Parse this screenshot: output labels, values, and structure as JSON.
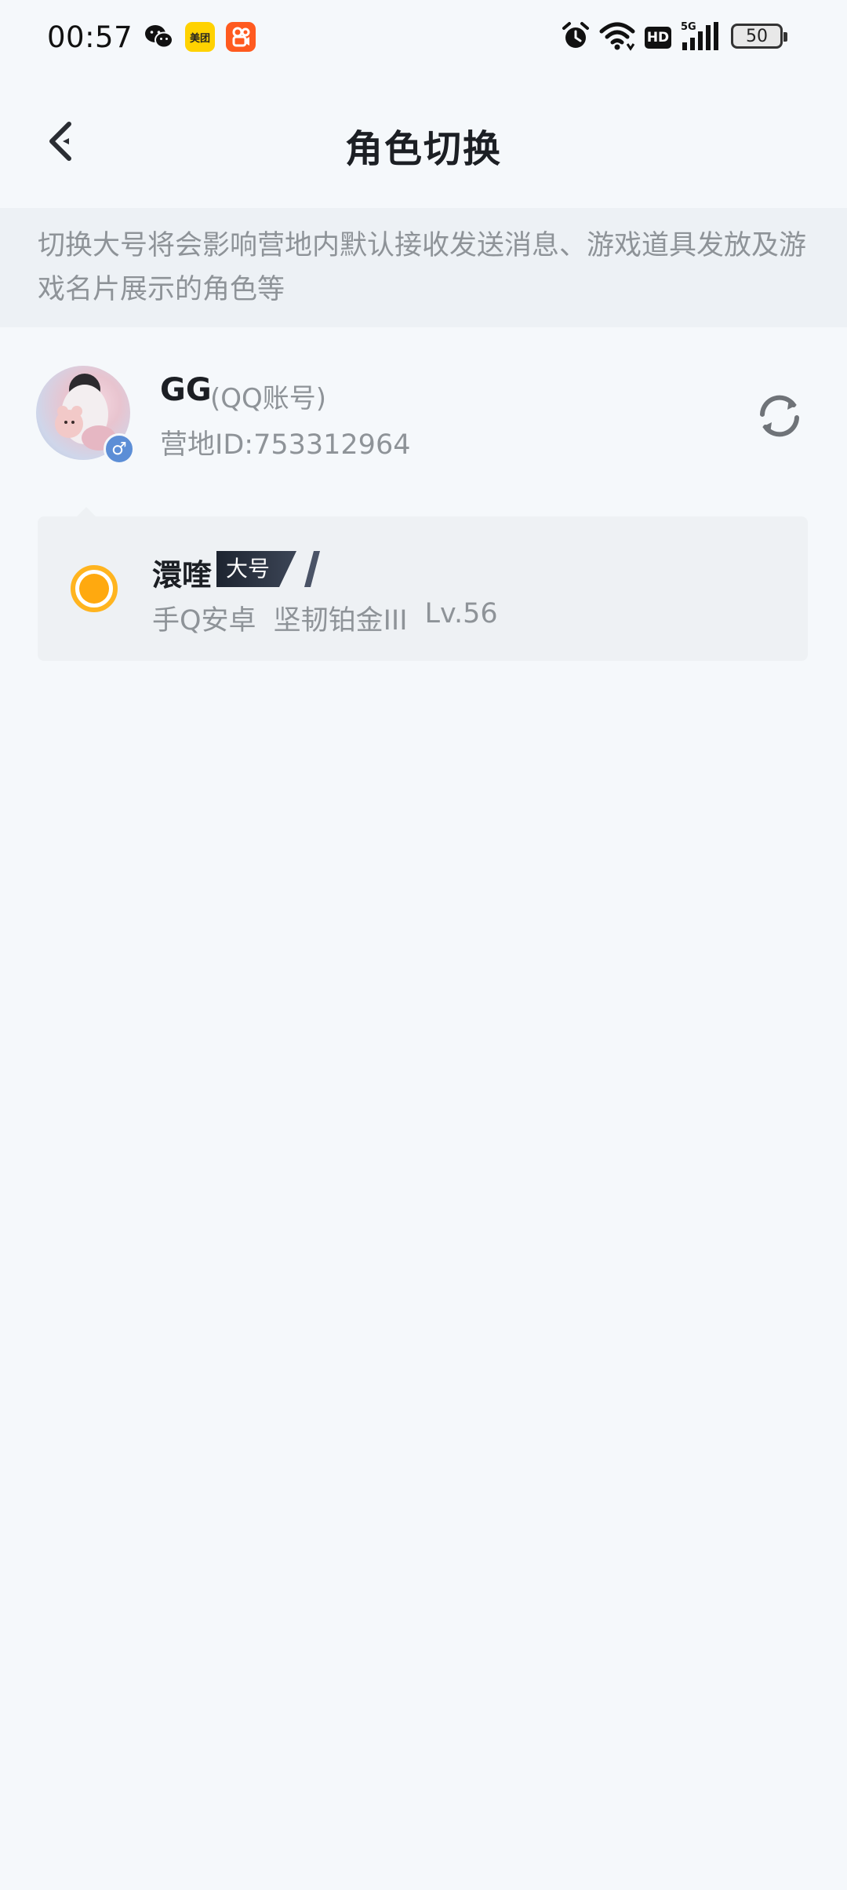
{
  "status_bar": {
    "time": "00:57",
    "apps": [
      "wechat-icon",
      "meituan-icon",
      "kuaishou-icon"
    ],
    "meituan_label": "美团",
    "hd_label": "HD",
    "network_label": "5G",
    "battery": "50"
  },
  "header": {
    "title": "角色切换",
    "back_icon": "chevron-left-icon"
  },
  "notice": {
    "text": "切换大号将会影响营地内默认接收发送消息、游戏道具发放及游戏名片展示的角色等"
  },
  "account": {
    "name": "GG",
    "type": "(QQ账号)",
    "id_text": "营地ID:753312964",
    "gender_symbol": "♂",
    "refresh_icon": "refresh-icon"
  },
  "roles": [
    {
      "name": "澴喹",
      "tag": "大号",
      "selected": true,
      "platform": "手Q安卓",
      "rank": "坚韧铂金III",
      "level": "Lv.56"
    }
  ],
  "colors": {
    "background": "#f5f8fb",
    "notice_bg": "#edf1f5",
    "muted_text": "#8e9398",
    "radio_accent": "#ffa90f",
    "gender_badge": "#5c8ed6",
    "tag_dark": "#1d2430"
  }
}
